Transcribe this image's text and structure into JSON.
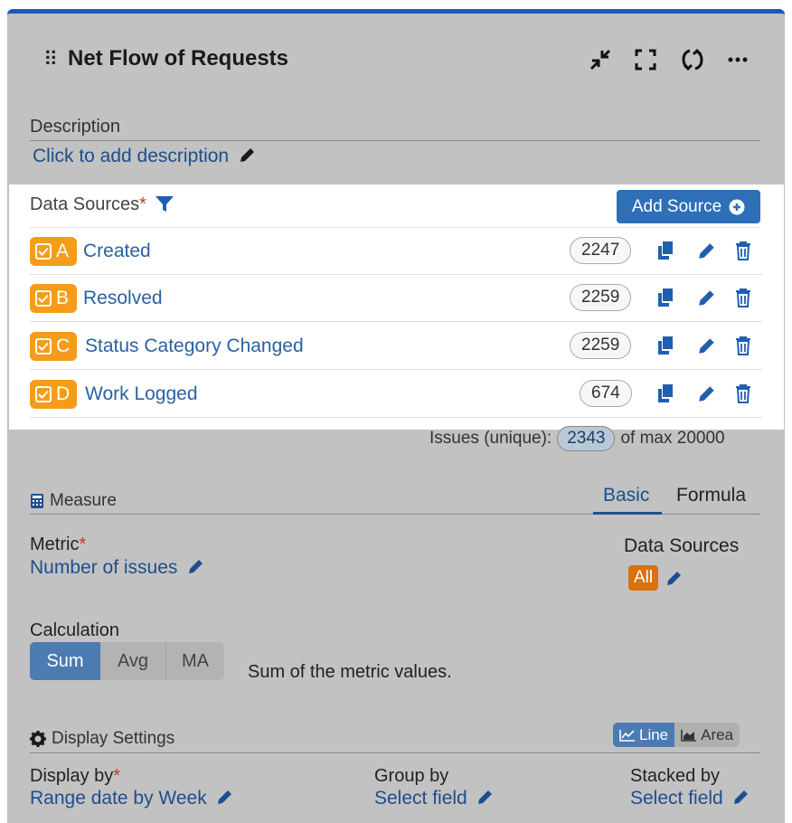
{
  "header": {
    "title": "Net Flow of Requests",
    "icons": [
      "drag-handle",
      "collapse",
      "fullscreen",
      "refresh",
      "more"
    ]
  },
  "description": {
    "label": "Description",
    "link": "Click to add description"
  },
  "data_sources": {
    "label": "Data Sources",
    "required_mark": "*",
    "add_button": "Add Source",
    "items": [
      {
        "letter": "A",
        "name": "Created",
        "count": "2247",
        "checked": true
      },
      {
        "letter": "B",
        "name": "Resolved",
        "count": "2259",
        "checked": true
      },
      {
        "letter": "C",
        "name": "Status Category Changed",
        "count": "2259",
        "checked": true
      },
      {
        "letter": "D",
        "name": "Work Logged",
        "count": "674",
        "checked": true
      }
    ],
    "issues_label": "Issues (unique):",
    "issues_count": "2343",
    "issues_max": "of max 20000"
  },
  "measure": {
    "label": "Measure",
    "tabs": [
      "Basic",
      "Formula"
    ],
    "active_tab": "Basic",
    "metric_label": "Metric",
    "metric_required": "*",
    "metric_value": "Number of issues",
    "ds_label": "Data Sources",
    "ds_value": "All",
    "calc_label": "Calculation",
    "calc_options": [
      "Sum",
      "Avg",
      "MA"
    ],
    "calc_selected": "Sum",
    "calc_description": "Sum of the metric values."
  },
  "display": {
    "label": "Display Settings",
    "chart_types": [
      "Line",
      "Area"
    ],
    "chart_selected": "Line",
    "display_by_label": "Display by",
    "display_by_required": "*",
    "display_by_value": "Range date by Week",
    "group_by_label": "Group by",
    "group_by_value": "Select field",
    "stacked_by_label": "Stacked by",
    "stacked_by_value": "Select field"
  },
  "colors": {
    "accent_blue": "#2e6fb8",
    "top_border": "#1a5cb7",
    "source_badge": "#f59c1a",
    "all_badge": "#d9720f",
    "link": "#1d4e8f"
  }
}
